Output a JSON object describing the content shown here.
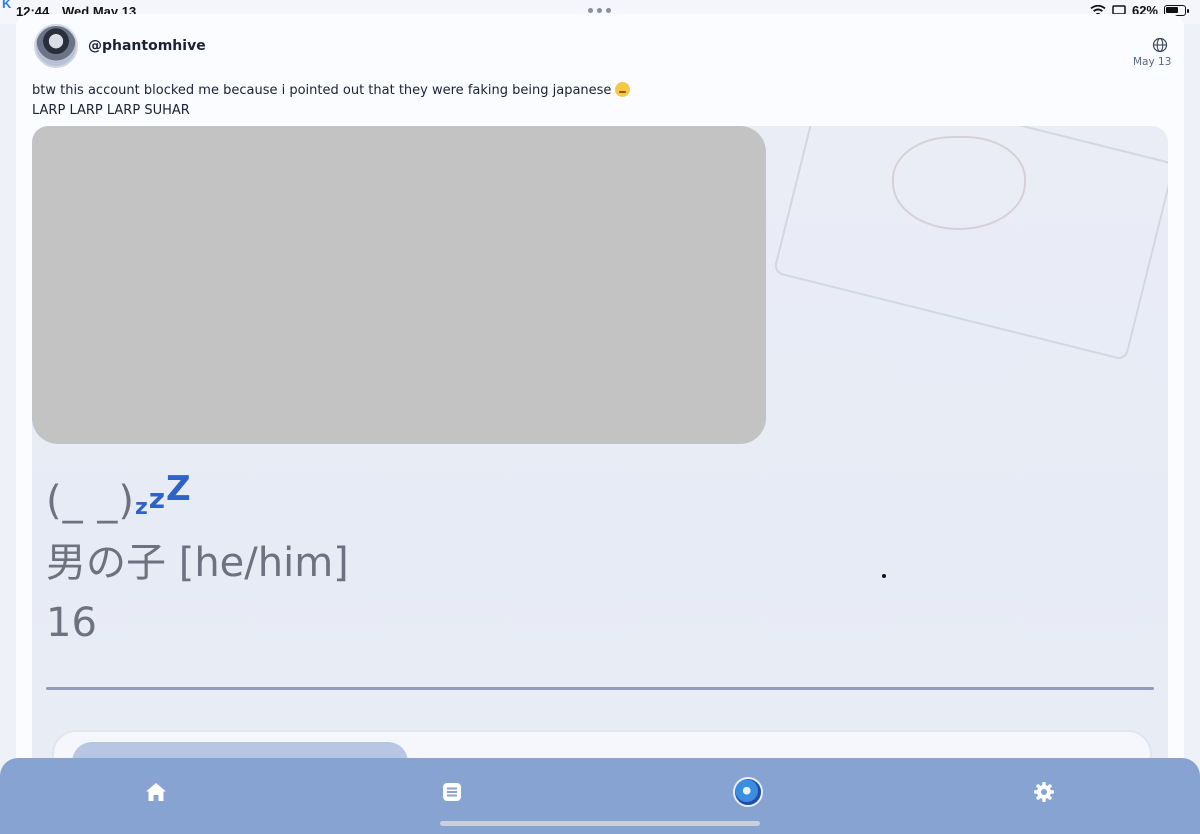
{
  "status_bar": {
    "app_mark": "K",
    "time": "12:44",
    "date": "Wed May 13",
    "battery": "62%"
  },
  "post": {
    "username": "@phantomhive",
    "date": "May 13",
    "text_line1": "btw this account blocked me because i pointed out that they were faking being japanese",
    "text_line2": "LARP LARP LARP SUHAR",
    "emoji": "loudly-crying-face-icon"
  },
  "image": {
    "bio_face": "(_ _)",
    "bio_z1": "z",
    "bio_z2": "z",
    "bio_z3": "Z",
    "bio_line2": "男の子 [he/him]",
    "bio_line3": "16"
  },
  "nav": {
    "items": [
      "home-icon",
      "feed-icon",
      "profile-icon",
      "settings-icon"
    ]
  },
  "colors": {
    "nav_bg": "#86a3d2",
    "accent_blue": "#2f63c7",
    "redacted_gray": "#c3c3c3"
  }
}
